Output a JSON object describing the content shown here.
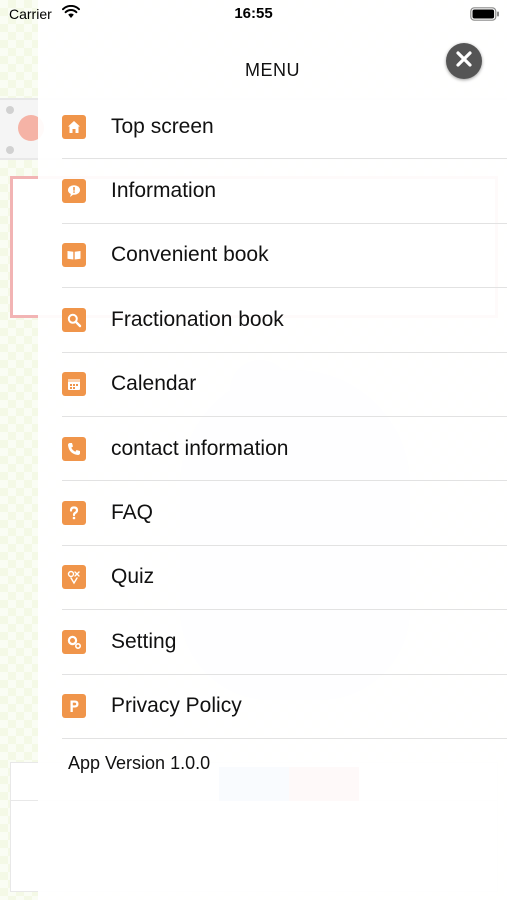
{
  "status_bar": {
    "carrier": "Carrier",
    "time": "16:55"
  },
  "menu": {
    "title": "MENU",
    "close_icon": "close-icon",
    "items": [
      {
        "label": "Top screen",
        "icon": "home-icon"
      },
      {
        "label": "Information",
        "icon": "info-bubble-icon"
      },
      {
        "label": "Convenient book",
        "icon": "book-icon"
      },
      {
        "label": "Fractionation book",
        "icon": "search-icon"
      },
      {
        "label": "Calendar",
        "icon": "calendar-icon"
      },
      {
        "label": "contact information",
        "icon": "phone-icon"
      },
      {
        "label": "FAQ",
        "icon": "question-icon"
      },
      {
        "label": "Quiz",
        "icon": "quiz-icon"
      },
      {
        "label": "Setting",
        "icon": "gear-icon"
      },
      {
        "label": "Privacy Policy",
        "icon": "privacy-p-icon"
      }
    ],
    "app_version": "App Version 1.0.0"
  },
  "colors": {
    "menu_icon_bg": "#f0954a",
    "close_button_bg": "#555555"
  }
}
